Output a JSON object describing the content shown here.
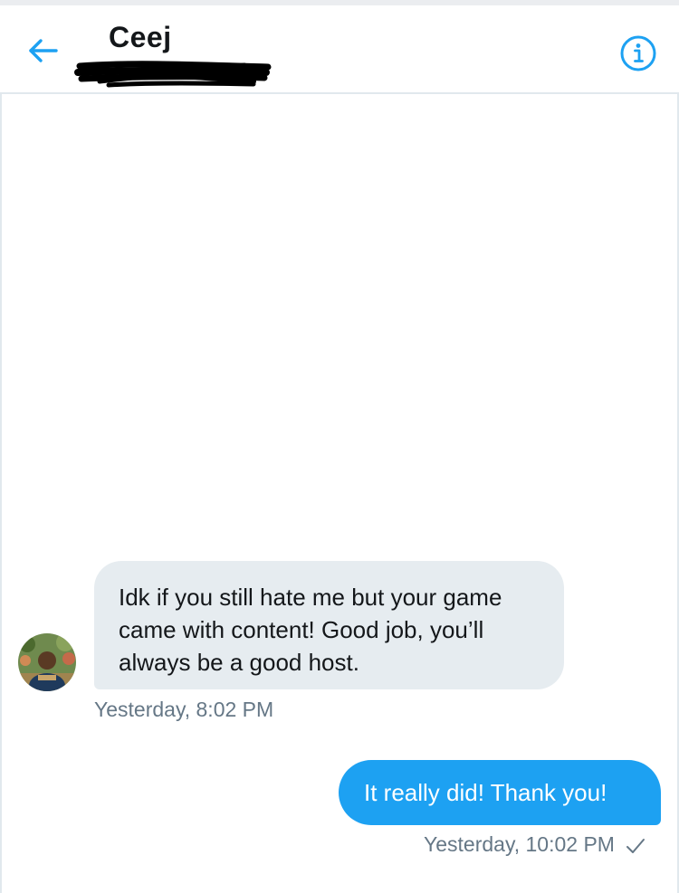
{
  "header": {
    "contact_name": "Ceej",
    "back_icon": "arrow-left-icon",
    "info_icon": "info-circle-icon",
    "accent_color": "#1da1f2"
  },
  "messages": [
    {
      "direction": "received",
      "text": "Idk if you still hate me but your game came with content! Good job, you’ll always be a good host.",
      "timestamp": "Yesterday, 8:02 PM",
      "bubble_color": "#e6ecf0"
    },
    {
      "direction": "sent",
      "text": "It really did! Thank you!",
      "timestamp": "Yesterday, 10:02 PM",
      "status_icon": "checkmark-icon",
      "bubble_color": "#1da1f2"
    }
  ]
}
